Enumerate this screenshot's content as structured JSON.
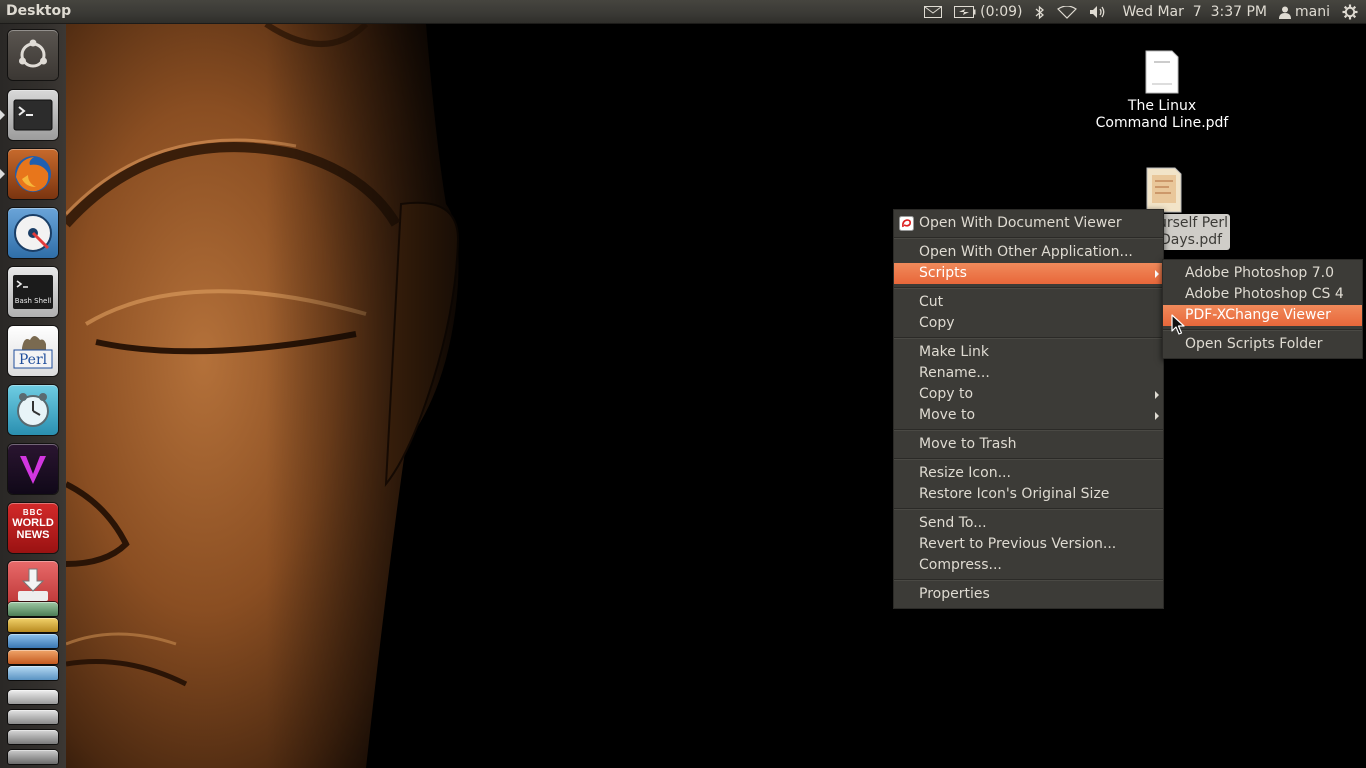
{
  "panel": {
    "title": "Desktop",
    "battery_text": "(0:09)",
    "clock": "Wed Mar  7  3:37 PM",
    "user": "mani",
    "icons": [
      "mail-icon",
      "battery-icon",
      "bluetooth-icon",
      "wifi-icon",
      "volume-icon",
      "user-icon",
      "gear-icon"
    ]
  },
  "launcher": {
    "items": [
      "ubuntu-dash",
      "terminal",
      "firefox",
      "disk-utility",
      "bash-shell",
      "perl",
      "app-clock",
      "app-v",
      "bbc-world-news",
      "installer",
      "stack-apps"
    ],
    "bbc_text": [
      "BBC",
      "WORLD",
      "NEWS"
    ],
    "bash_label": "Bash Shell",
    "perl_label": "Perl"
  },
  "desktop": {
    "files": [
      {
        "line1": "The Linux",
        "line2": "Command Line.pdf"
      },
      {
        "line1": "urself Perl",
        "line2": "Days.pdf"
      }
    ]
  },
  "context_menu": {
    "groups": [
      [
        {
          "label": "Open With Document Viewer"
        }
      ],
      [
        {
          "label": "Open With Other Application..."
        },
        {
          "label": "Scripts"
        }
      ],
      [
        {
          "label": "Cut"
        },
        {
          "label": "Copy"
        }
      ],
      [
        {
          "label": "Make Link"
        },
        {
          "label": "Rename..."
        },
        {
          "label": "Copy to"
        },
        {
          "label": "Move to"
        }
      ],
      [
        {
          "label": "Move to Trash"
        }
      ],
      [
        {
          "label": "Resize Icon..."
        },
        {
          "label": "Restore Icon's Original Size"
        }
      ],
      [
        {
          "label": "Send To..."
        },
        {
          "label": "Revert to Previous Version..."
        },
        {
          "label": "Compress..."
        }
      ],
      [
        {
          "label": "Properties"
        }
      ]
    ]
  },
  "scripts_menu": {
    "items": [
      "Adobe Photoshop 7.0",
      "Adobe Photoshop CS 4",
      "PDF-XChange Viewer",
      "Open Scripts Folder"
    ]
  },
  "colors": {
    "highlight": "#e8673a",
    "menu_bg": "#3c3b37",
    "panel_bg": "#3a3935"
  }
}
